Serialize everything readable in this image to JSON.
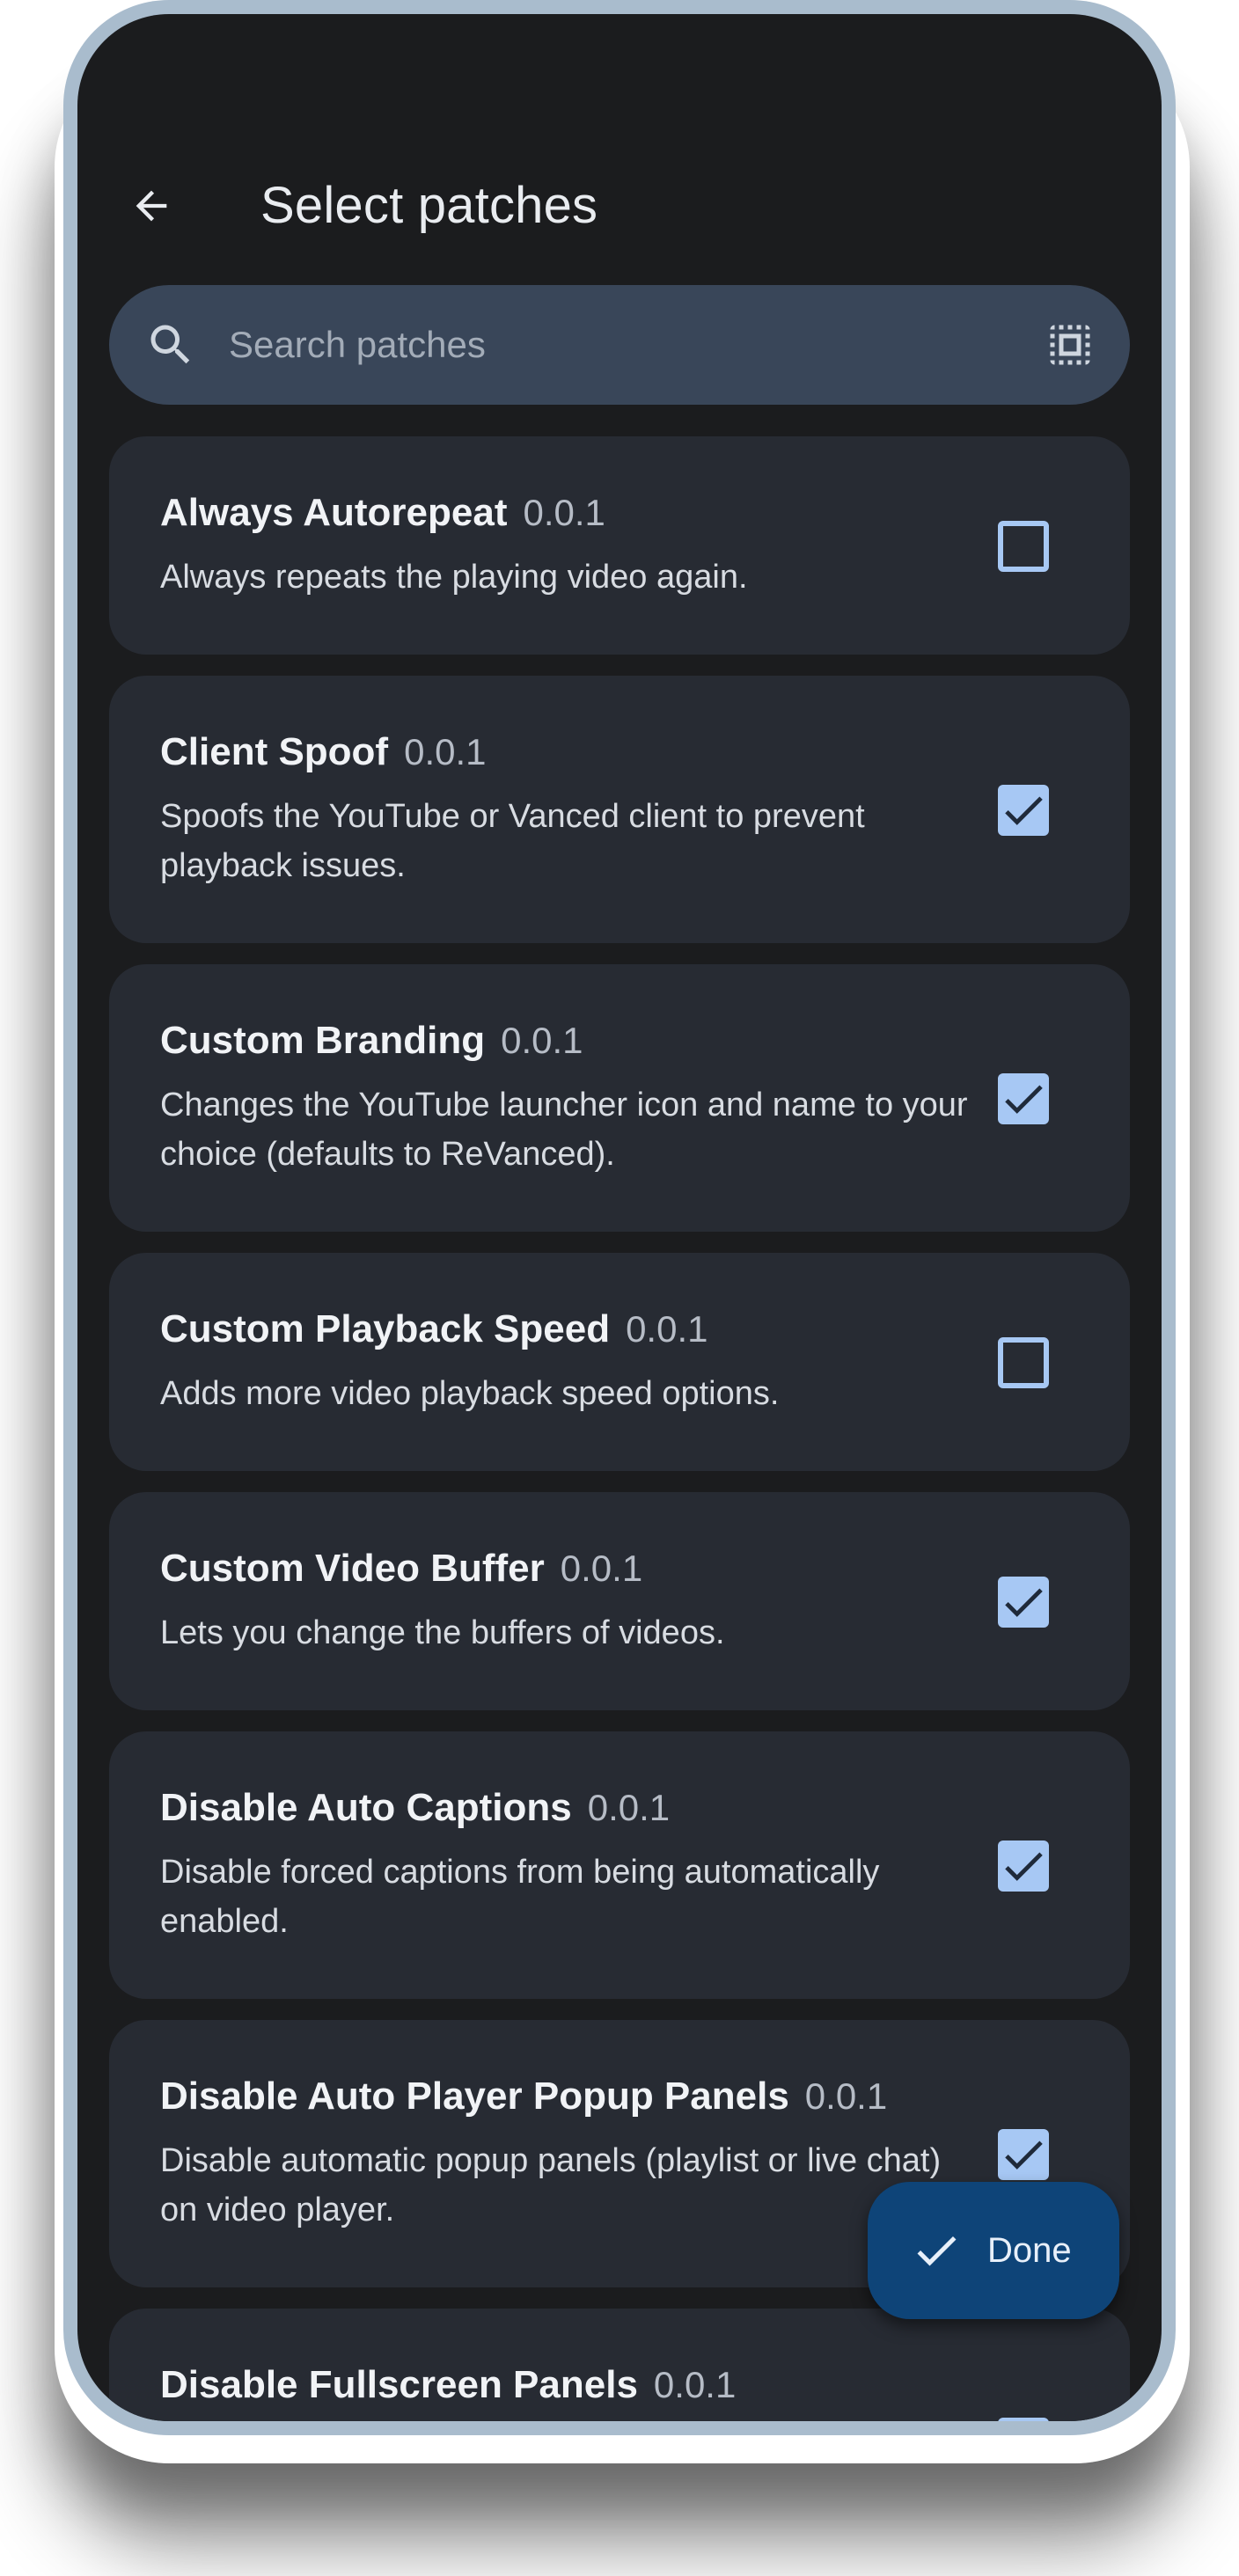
{
  "header": {
    "title": "Select patches"
  },
  "search": {
    "placeholder": "Search patches"
  },
  "icons": {
    "back": "arrow-back-icon",
    "search": "search-icon",
    "select_all": "select-all-icon",
    "check": "check-icon"
  },
  "colors": {
    "background": "#1b1c1e",
    "card": "#272b33",
    "accent": "#a7c8f4",
    "fab": "#0e4478",
    "search_bar": "#394659"
  },
  "patches": [
    {
      "name": "Always Autorepeat",
      "version": "0.0.1",
      "description": "Always repeats the playing video again.",
      "checked": false
    },
    {
      "name": "Client Spoof",
      "version": "0.0.1",
      "description": "Spoofs the YouTube or Vanced client to prevent playback issues.",
      "checked": true
    },
    {
      "name": "Custom Branding",
      "version": "0.0.1",
      "description": "Changes the YouTube launcher icon and name to your choice (defaults to ReVanced).",
      "checked": true
    },
    {
      "name": "Custom Playback Speed",
      "version": "0.0.1",
      "description": "Adds more video playback speed options.",
      "checked": false
    },
    {
      "name": "Custom Video Buffer",
      "version": "0.0.1",
      "description": "Lets you change the buffers of videos.",
      "checked": true
    },
    {
      "name": "Disable Auto Captions",
      "version": "0.0.1",
      "description": "Disable forced captions from being automatically enabled.",
      "checked": true
    },
    {
      "name": "Disable Auto Player Popup Panels",
      "version": "0.0.1",
      "description": "Disable automatic popup panels (playlist or live chat) on video player.",
      "checked": true
    },
    {
      "name": "Disable Fullscreen Panels",
      "version": "0.0.1",
      "description": "",
      "checked": true
    }
  ],
  "fab": {
    "label": "Done"
  }
}
